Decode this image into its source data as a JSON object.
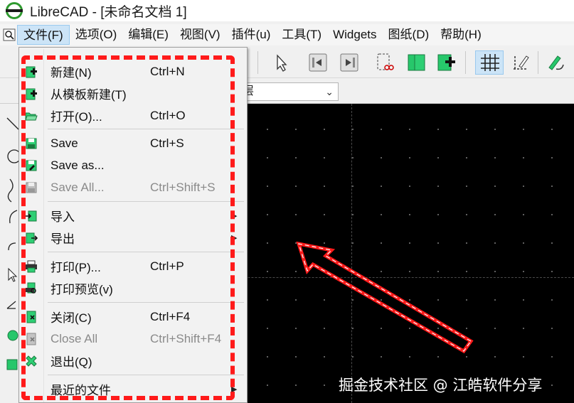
{
  "window": {
    "title": "LibreCAD - [未命名文档 1]"
  },
  "menubar": {
    "items": [
      {
        "label": "文件(F)",
        "active": true
      },
      {
        "label": "选项(O)"
      },
      {
        "label": "编辑(E)"
      },
      {
        "label": "视图(V)"
      },
      {
        "label": "插件(u)"
      },
      {
        "label": "工具(T)"
      },
      {
        "label": "Widgets"
      },
      {
        "label": "图纸(D)"
      },
      {
        "label": "帮助(H)"
      }
    ]
  },
  "toolbar": {
    "layer_combo_value": "层"
  },
  "file_menu": {
    "items": [
      {
        "label": "新建(N)",
        "shortcut": "Ctrl+N",
        "icon": "new-document-icon"
      },
      {
        "label": "从模板新建(T)",
        "shortcut": "",
        "icon": "new-from-template-icon"
      },
      {
        "label": "打开(O)...",
        "shortcut": "Ctrl+O",
        "icon": "open-folder-icon"
      },
      {
        "label": "Save",
        "shortcut": "Ctrl+S",
        "icon": "save-icon"
      },
      {
        "label": "Save as...",
        "shortcut": "",
        "icon": "save-as-icon"
      },
      {
        "label": "Save All...",
        "shortcut": "Ctrl+Shift+S",
        "icon": "save-all-icon",
        "disabled": true
      },
      {
        "label": "导入",
        "shortcut": "",
        "icon": "import-icon",
        "submenu": true
      },
      {
        "label": "导出",
        "shortcut": "",
        "icon": "export-icon",
        "submenu": true
      },
      {
        "label": "打印(P)...",
        "shortcut": "Ctrl+P",
        "icon": "print-icon"
      },
      {
        "label": "打印预览(v)",
        "shortcut": "",
        "icon": "print-preview-icon"
      },
      {
        "label": "关闭(C)",
        "shortcut": "Ctrl+F4",
        "icon": "close-document-icon"
      },
      {
        "label": "Close All",
        "shortcut": "Ctrl+Shift+F4",
        "icon": "close-all-icon",
        "disabled": true
      },
      {
        "label": "退出(Q)",
        "shortcut": "",
        "icon": "exit-icon"
      },
      {
        "label": "最近的文件",
        "shortcut": "",
        "icon": "",
        "submenu": true
      }
    ]
  },
  "watermark": {
    "text": "掘金技术社区 @ 江皓软件分享"
  },
  "colors": {
    "accent_green": "#2f9a2f",
    "highlight_red": "#ff1a1a",
    "canvas_bg": "#000000"
  }
}
